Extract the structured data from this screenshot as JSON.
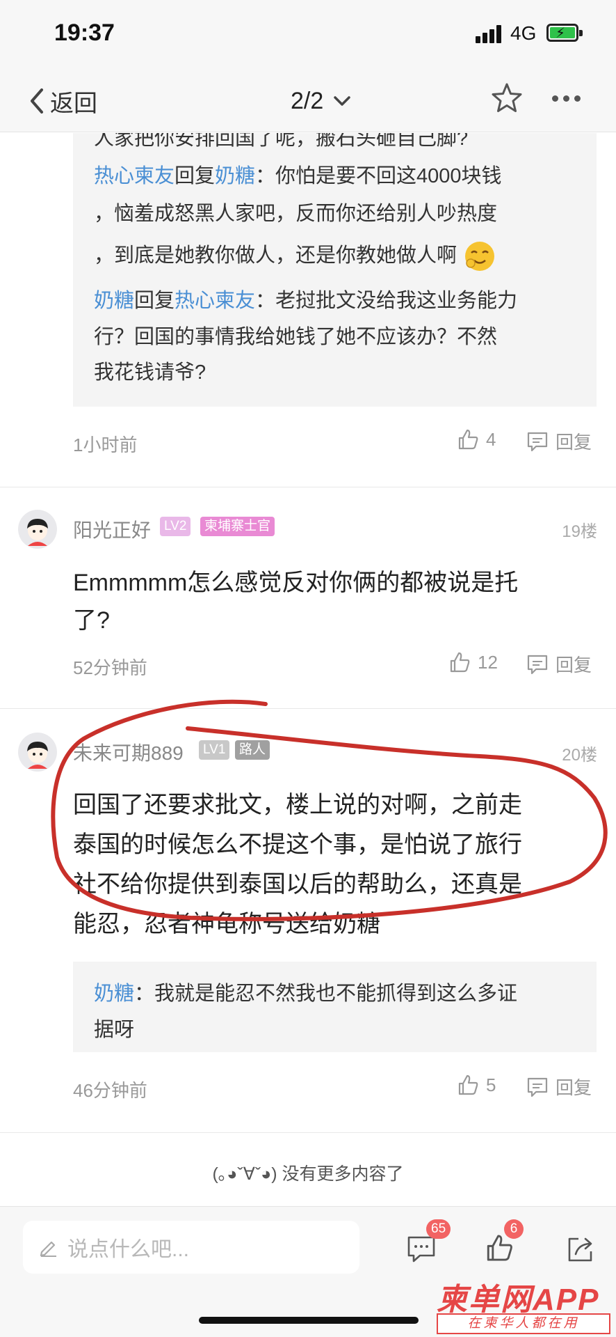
{
  "status_bar": {
    "time": "19:37",
    "network": "4G"
  },
  "nav": {
    "back_label": "返回",
    "page_indicator": "2/2"
  },
  "thread_top": {
    "reply_lines": [
      {
        "name_a": "",
        "mid": "",
        "name_b": "",
        "text": "人家把你安排回国了呢，搬石头砸自己脚?"
      },
      {
        "name_a": "热心柬友",
        "mid": "回复",
        "name_b": "奶糖",
        "text": "：你怕是要不回这4000块钱"
      },
      {
        "name_a": "",
        "mid": "",
        "name_b": "",
        "text": "，恼羞成怒黑人家吧，反而你还给别人吵热度"
      },
      {
        "name_a": "",
        "mid": "",
        "name_b": "",
        "text": "，到底是她教你做人，还是你教她做人啊"
      },
      {
        "name_a": "奶糖",
        "mid": "回复",
        "name_b": "热心柬友",
        "text": "：老挝批文没给我这业务能力"
      },
      {
        "name_a": "",
        "mid": "",
        "name_b": "",
        "text": "行？回国的事情我给她钱了她不应该办？不然"
      },
      {
        "name_a": "",
        "mid": "",
        "name_b": "",
        "text": "我花钱请爷?"
      }
    ],
    "time": "1小时前",
    "likes": "4",
    "reply_label": "回复"
  },
  "comment_19": {
    "username": "阳光正好",
    "level": "LV2",
    "tag": "柬埔寨士官",
    "floor": "19楼",
    "body_lines": [
      "Emmmmm怎么感觉反对你俩的都被说是托",
      "了?"
    ],
    "time": "52分钟前",
    "likes": "12",
    "reply_label": "回复"
  },
  "comment_20": {
    "username": "未来可期889",
    "level": "LV1",
    "tag": "路人",
    "floor": "20楼",
    "body_lines": [
      "回国了还要求批文，楼上说的对啊，之前走",
      "泰国的时候怎么不提这个事，是怕说了旅行",
      "社不给你提供到泰国以后的帮助么，还真是",
      "能忍，忍者神龟称号送给奶糖"
    ],
    "reply": {
      "name": "奶糖",
      "lines": [
        "：我就是能忍不然我也不能抓得到这么多证",
        "据呀"
      ]
    },
    "time": "46分钟前",
    "likes": "5",
    "reply_label": "回复"
  },
  "end_tip": "(｡◕ˇ∀ˇ◕) 没有更多内容了",
  "bottom_bar": {
    "input_placeholder": "说点什么吧...",
    "comment_badge": "65",
    "like_badge": "6"
  },
  "watermark": {
    "main": "柬单网APP",
    "sub": "在柬华人都在用"
  },
  "colors": {
    "link_blue": "#4a8fd4",
    "annotation_red": "#c8302a",
    "badge_red": "#f26363",
    "watermark_red": "#e54646"
  },
  "icons": [
    "chevron-left-icon",
    "chevron-down-icon",
    "star-icon",
    "more-icon",
    "thumb-up-icon",
    "comment-icon",
    "pencil-icon",
    "share-icon",
    "emoji-icon",
    "avatar"
  ]
}
